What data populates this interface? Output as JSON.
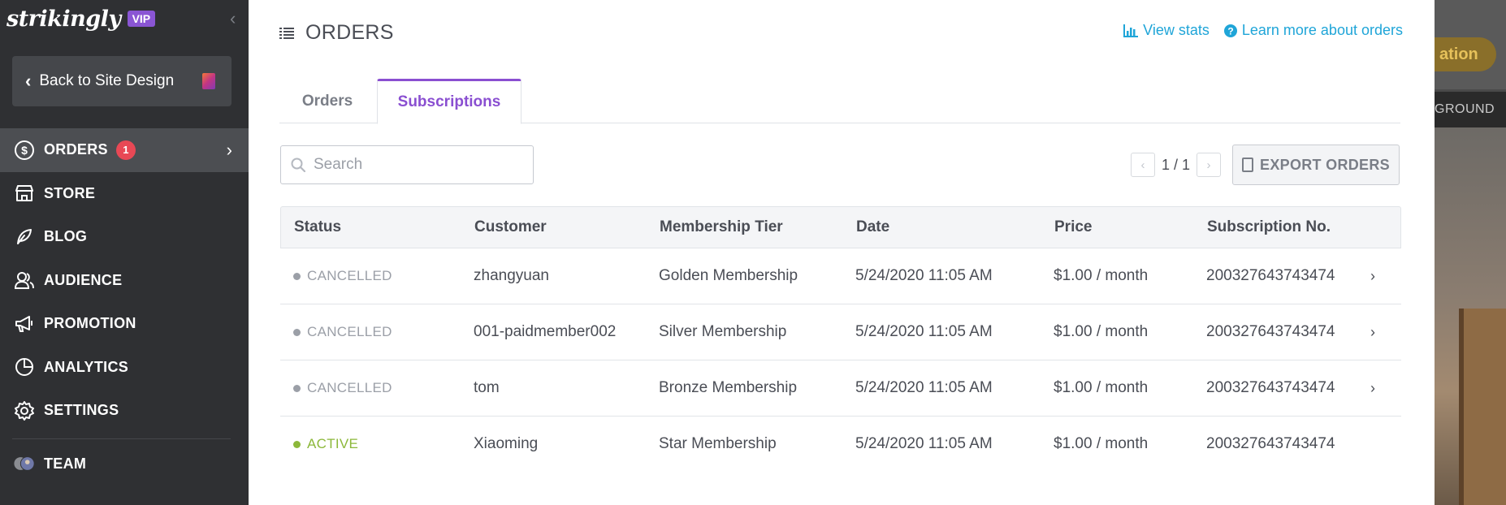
{
  "sidebar": {
    "brand": "strikingly",
    "vip_badge": "VIP",
    "collapse_icon": "‹",
    "back_button": "Back to Site Design",
    "items": [
      {
        "label": "ORDERS",
        "icon": "dollar-circle-icon",
        "badge": "1",
        "active": true
      },
      {
        "label": "STORE",
        "icon": "store-icon"
      },
      {
        "label": "BLOG",
        "icon": "feather-icon"
      },
      {
        "label": "AUDIENCE",
        "icon": "audience-icon"
      },
      {
        "label": "PROMOTION",
        "icon": "megaphone-icon"
      },
      {
        "label": "ANALYTICS",
        "icon": "pie-chart-icon"
      },
      {
        "label": "SETTINGS",
        "icon": "gear-icon"
      },
      {
        "label": "TEAM",
        "icon": "team-avatars-icon"
      }
    ]
  },
  "background": {
    "button_fragment": "ation",
    "bar_fragment": "GROUND"
  },
  "main": {
    "title": "ORDERS",
    "links": {
      "view_stats": "View stats",
      "learn_more": "Learn more about orders"
    },
    "tabs": [
      "Orders",
      "Subscriptions"
    ],
    "active_tab": "Subscriptions",
    "search": {
      "placeholder": "Search",
      "value": ""
    },
    "pager": {
      "text": "1 / 1"
    },
    "export_label": "EXPORT ORDERS",
    "table": {
      "columns": [
        "Status",
        "Customer",
        "Membership Tier",
        "Date",
        "Price",
        "Subscription No."
      ],
      "rows": [
        {
          "status": "CANCELLED",
          "customer": "zhangyuan",
          "tier": "Golden Membership",
          "date": "5/24/2020 11:05 AM",
          "price": "$1.00 / month",
          "sub_no": "200327643743474",
          "has_arrow": true
        },
        {
          "status": "CANCELLED",
          "customer": "001-paidmember002",
          "tier": "Silver Membership",
          "date": "5/24/2020 11:05 AM",
          "price": "$1.00 / month",
          "sub_no": "200327643743474",
          "has_arrow": true
        },
        {
          "status": "CANCELLED",
          "customer": "tom",
          "tier": "Bronze Membership",
          "date": "5/24/2020 11:05 AM",
          "price": "$1.00 / month",
          "sub_no": "200327643743474",
          "has_arrow": true
        },
        {
          "status": "ACTIVE",
          "customer": "Xiaoming",
          "tier": "Star Membership",
          "date": "5/24/2020 11:05 AM",
          "price": "$1.00 / month",
          "sub_no": "200327643743474",
          "has_arrow": false
        }
      ]
    }
  },
  "colors": {
    "sidebar_bg": "#2f3033",
    "accent_purple": "#8a4fd1",
    "link_blue": "#1fa5d8",
    "cancelled_gray": "#9b9fa7",
    "active_green": "#8cb83a",
    "badge_red": "#e84855"
  }
}
